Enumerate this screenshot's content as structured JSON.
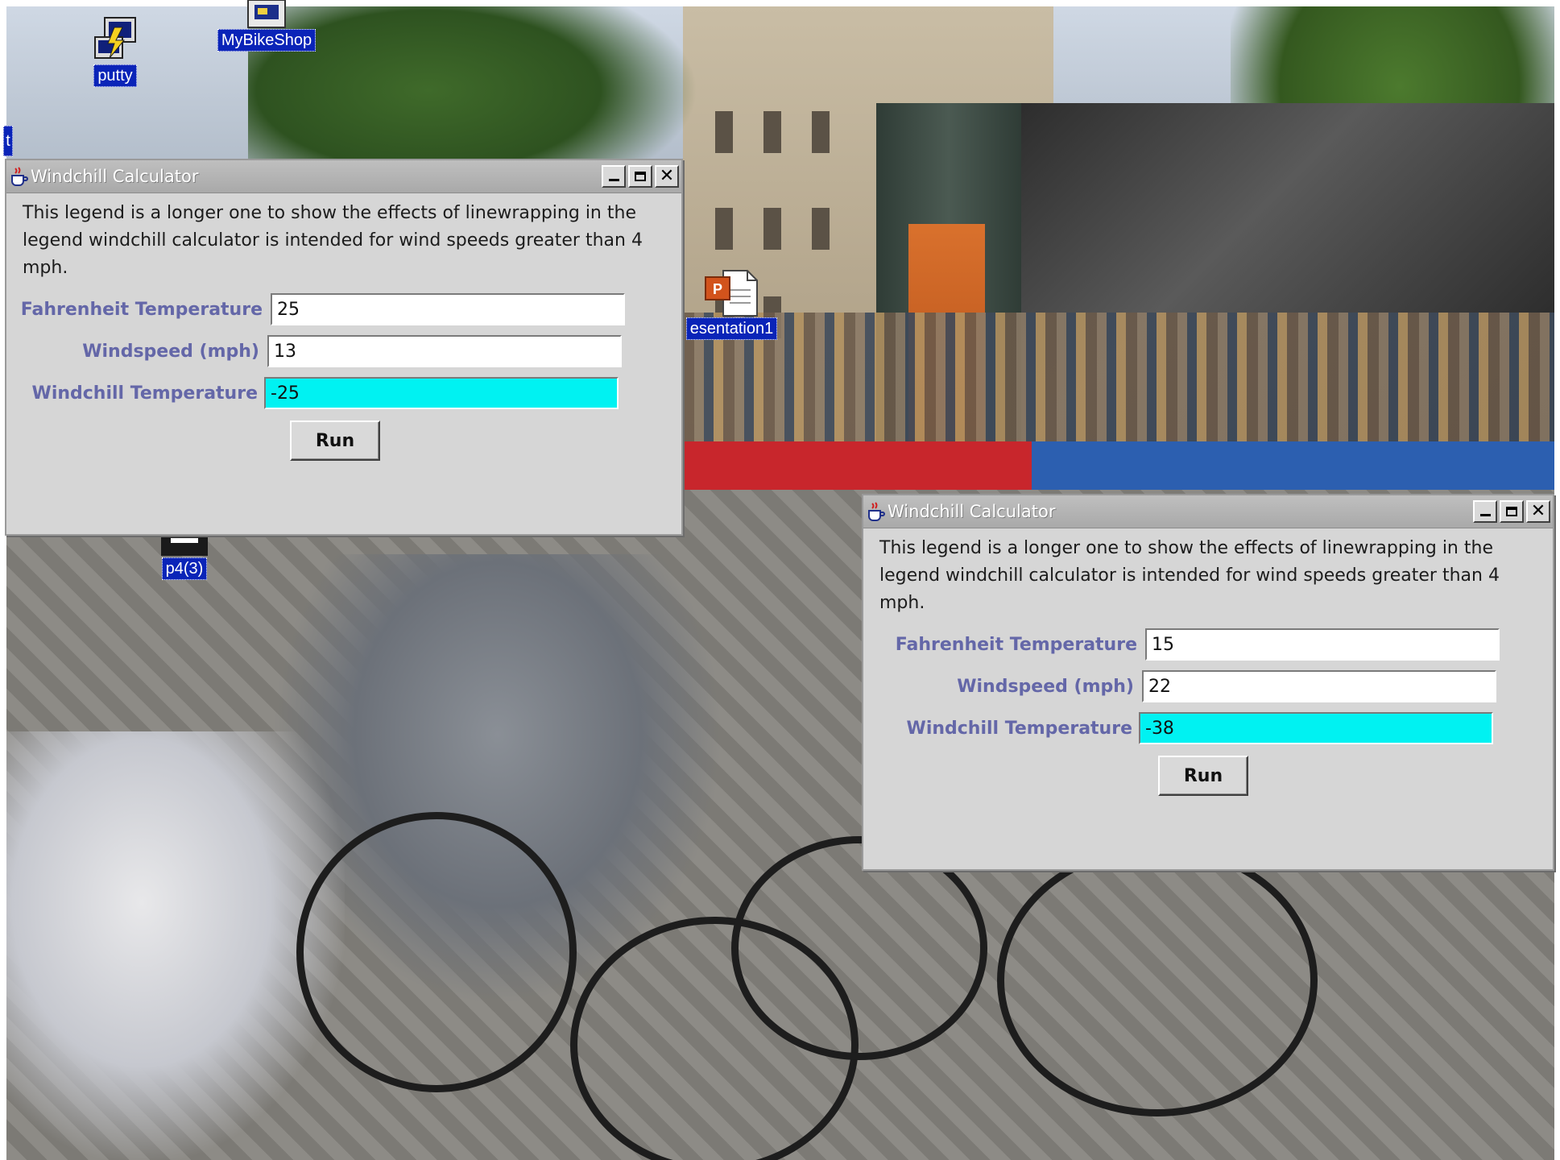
{
  "desktop": {
    "icons": [
      {
        "label": "MyBikeShop",
        "icon": "computer-icon"
      },
      {
        "label": "putty",
        "icon": "putty-terminal-icon"
      },
      {
        "label": "esentation1",
        "icon": "powerpoint-document-icon"
      },
      {
        "label": "p4(3)",
        "icon": "application-icon"
      },
      {
        "label": "t",
        "icon": "partial-icon"
      }
    ]
  },
  "windows": [
    {
      "title": "Windchill Calculator",
      "legend": "This legend is a longer one to show the effects of linewrapping in the legend windchill calculator is intended for wind speeds greater than 4 mph.",
      "fields": {
        "fahrenheit_label": "Fahrenheit Temperature",
        "fahrenheit_value": "25",
        "windspeed_label": "Windspeed (mph)",
        "windspeed_value": "13",
        "windchill_label": "Windchill Temperature",
        "windchill_value": "-25"
      },
      "run_label": "Run"
    },
    {
      "title": "Windchill Calculator",
      "legend": "This legend is a longer one to show the effects of linewrapping in the legend windchill calculator is intended for wind speeds greater than 4 mph.",
      "fields": {
        "fahrenheit_label": "Fahrenheit Temperature",
        "fahrenheit_value": "15",
        "windspeed_label": "Windspeed (mph)",
        "windspeed_value": "22",
        "windchill_label": "Windchill Temperature",
        "windchill_value": "-38"
      },
      "run_label": "Run"
    }
  ],
  "colors": {
    "label_text": "#6467a8",
    "result_background": "#00f2f2",
    "window_background": "#d6d6d6",
    "icon_label_background": "#0a24b8"
  }
}
